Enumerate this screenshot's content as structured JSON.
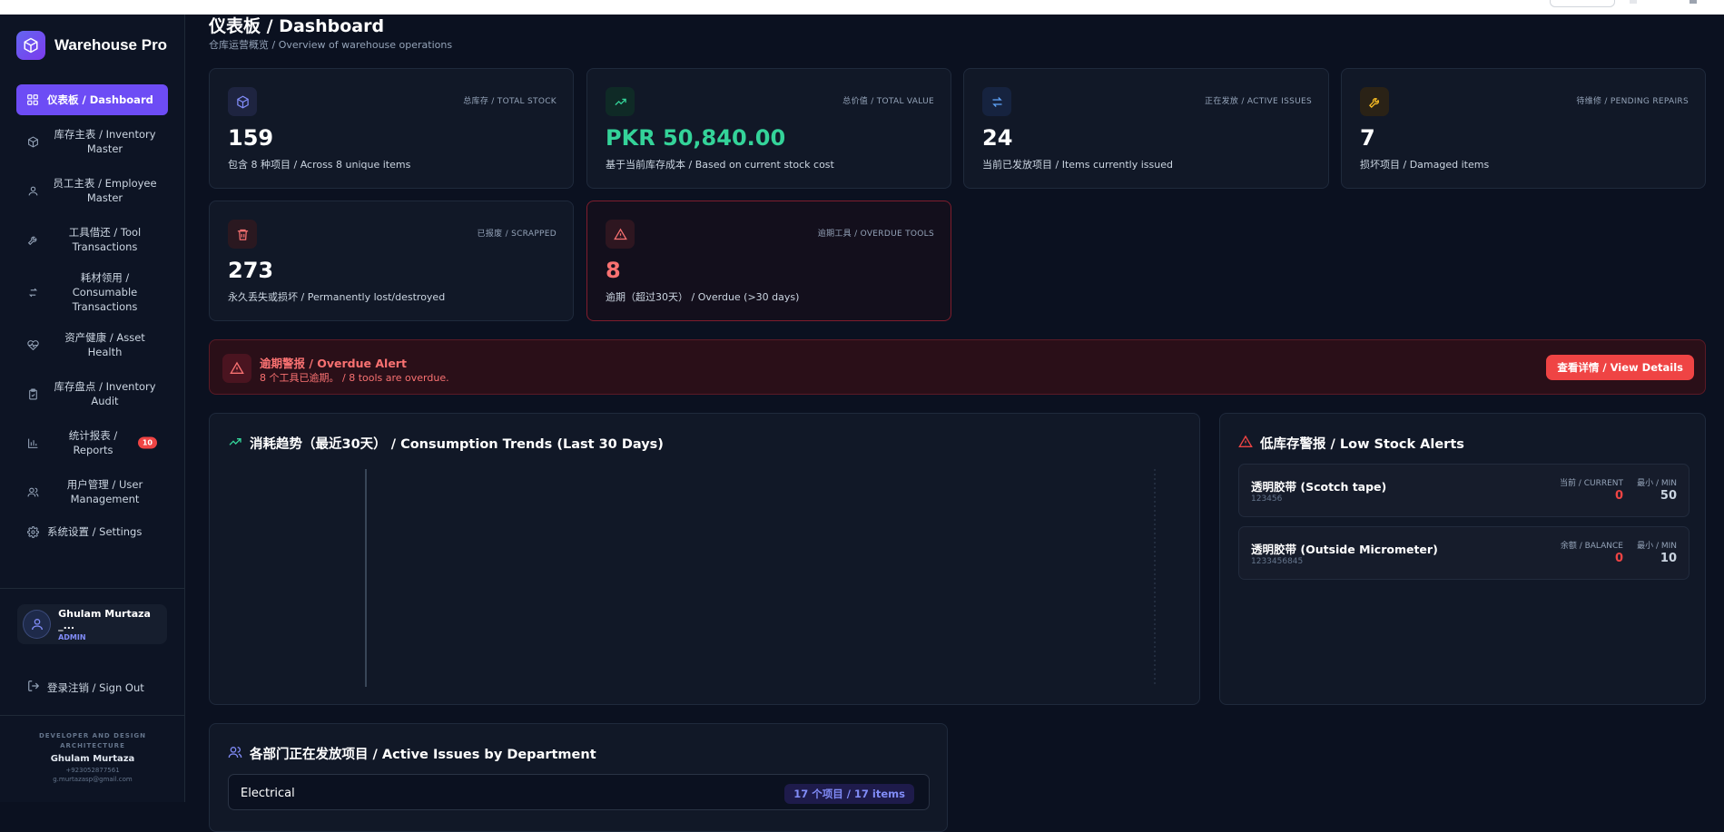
{
  "app": {
    "name": "Warehouse Pro"
  },
  "sidebar": {
    "items": [
      {
        "label": "仪表板 / Dashboard",
        "icon": "dashboard-icon",
        "active": true
      },
      {
        "label": "库存主表 / Inventory Master",
        "icon": "box-icon"
      },
      {
        "label": "员工主表 / Employee Master",
        "icon": "user-icon"
      },
      {
        "label": "工具借还 / Tool Transactions",
        "icon": "wrench-icon"
      },
      {
        "label": "耗材领用 / Consumable Transactions",
        "icon": "swap-icon"
      },
      {
        "label": "资产健康 / Asset Health",
        "icon": "heart-pulse-icon"
      },
      {
        "label": "库存盘点 / Inventory Audit",
        "icon": "clipboard-check-icon"
      },
      {
        "label": "统计报表 / Reports",
        "icon": "bar-chart-icon",
        "badge": "10"
      },
      {
        "label": "用户管理 / User Management",
        "icon": "users-icon"
      },
      {
        "label": "系统设置 / Settings",
        "icon": "gear-icon"
      }
    ],
    "user": {
      "name": "Ghulam Murtaza _...",
      "role": "ADMIN"
    },
    "signout": "登录注销 / Sign Out",
    "credits": {
      "line1": "DEVELOPER AND DESIGN",
      "line2": "ARCHITECTURE",
      "name": "Ghulam Murtaza",
      "phone": "+923052877561",
      "email": "g.murtazasp@gmail.com"
    }
  },
  "header": {
    "title": "仪表板 / Dashboard",
    "subtitle": "仓库运营概览 / Overview of warehouse operations"
  },
  "stats": [
    {
      "label": "总库存 / TOTAL STOCK",
      "value": "159",
      "desc": "包含 8 种项目 / Across 8 unique items",
      "icon": "cube-icon",
      "color": "#818cf8",
      "bg": "#1e2440"
    },
    {
      "label": "总价值 / TOTAL VALUE",
      "value": "PKR 50,840.00",
      "desc": "基于当前库存成本 / Based on current stock cost",
      "icon": "trending-up-icon",
      "color": "#34d399",
      "bg": "#0f2a26"
    },
    {
      "label": "正在发放 / ACTIVE ISSUES",
      "value": "24",
      "desc": "当前已发放项目 / Items currently issued",
      "icon": "arrows-exchange-icon",
      "color": "#60a5fa",
      "bg": "#16233f"
    },
    {
      "label": "待维修 / PENDING REPAIRS",
      "value": "7",
      "desc": "损坏项目 / Damaged items",
      "icon": "wrench-icon",
      "color": "#fbbf24",
      "bg": "#2a2216"
    },
    {
      "label": "已报废 / SCRAPPED",
      "value": "273",
      "desc": "永久丢失或损坏 / Permanently lost/destroyed",
      "icon": "trash-icon",
      "color": "#f87171",
      "bg": "#2a1820"
    },
    {
      "label": "逾期工具 / OVERDUE TOOLS",
      "value": "8",
      "desc": "逾期（超过30天） / Overdue (>30 days)",
      "icon": "warning-icon",
      "color": "#f87171",
      "bg": "#2e1620"
    }
  ],
  "alert": {
    "title": "逾期警报 / Overdue Alert",
    "message": "8 个工具已逾期。 / 8 tools are overdue.",
    "button": "查看详情 / View Details"
  },
  "trends": {
    "title": "消耗趋势（最近30天） / Consumption Trends (Last 30 Days)"
  },
  "low_stock": {
    "title": "低库存警报 / Low Stock Alerts",
    "items": [
      {
        "name": "透明胶带 (Scotch tape)",
        "code": "123456",
        "current_label": "当前 / CURRENT",
        "current": "0",
        "min_label": "最小 / MIN",
        "min": "50"
      },
      {
        "name": "透明胶带 (Outside Micrometer)",
        "code": "1233456845",
        "current_label": "余额 / BALANCE",
        "current": "0",
        "min_label": "最小 / MIN",
        "min": "10"
      }
    ]
  },
  "departments": {
    "title": "各部门正在发放项目 / Active Issues by Department",
    "rows": [
      {
        "name": "Electrical",
        "count": "17 个项目 / 17 items"
      }
    ]
  },
  "colors": {
    "accent": "#6d4cf5",
    "danger": "#ef4444",
    "success": "#34d399"
  }
}
